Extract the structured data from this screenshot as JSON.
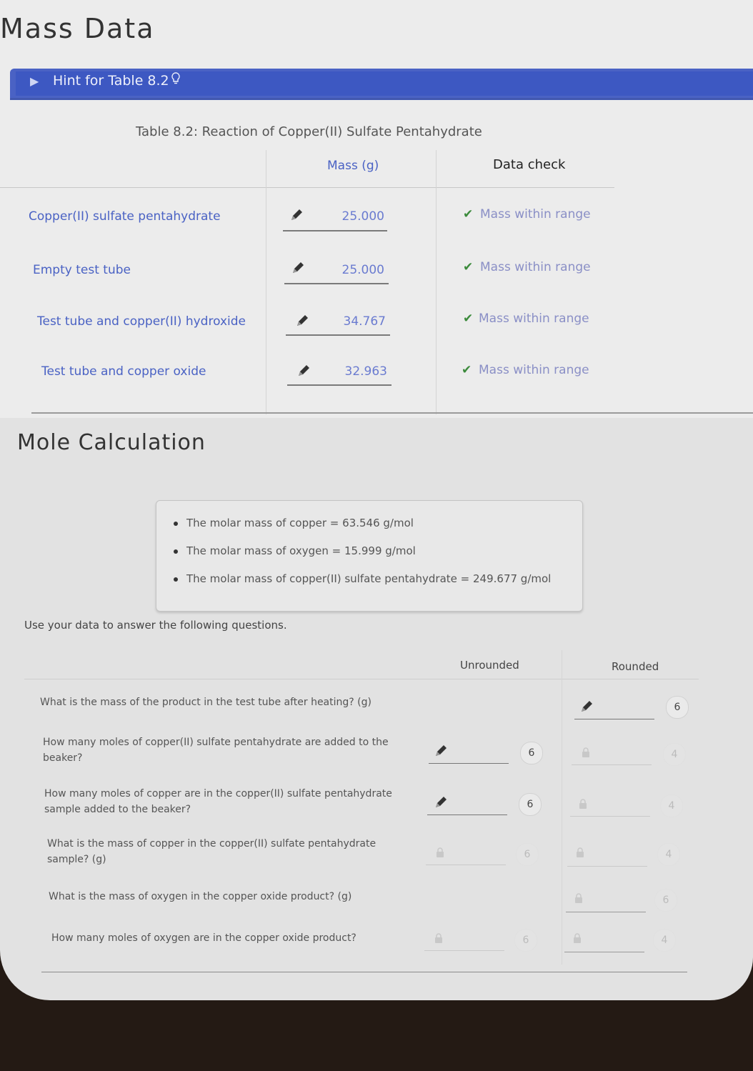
{
  "headings": {
    "mass_data": "Mass Data",
    "mole_calculation": "Mole Calculation"
  },
  "hint": {
    "label": "Hint for Table 8.2"
  },
  "mass_table": {
    "caption": "Table 8.2: Reaction of Copper(II) Sulfate Pentahydrate",
    "col_mass": "Mass (g)",
    "col_check": "Data check",
    "rows": [
      {
        "label": "Copper(II) sulfate pentahydrate",
        "value": "25.000",
        "check": "Mass within range"
      },
      {
        "label": "Empty test tube",
        "value": "25.000",
        "check": "Mass within range"
      },
      {
        "label": "Test tube and copper(II) hydroxide",
        "value": "34.767",
        "check": "Mass within range"
      },
      {
        "label": "Test tube and copper oxide",
        "value": "32.963",
        "check": "Mass within range"
      }
    ]
  },
  "molar_masses": [
    "The molar mass of copper = 63.546 g/mol",
    "The molar mass of oxygen = 15.999 g/mol",
    "The molar mass of copper(II) sulfate pentahydrate = 249.677 g/mol"
  ],
  "instructions": "Use your data to answer the following questions.",
  "questions_table": {
    "col_unrounded": "Unrounded",
    "col_rounded": "Rounded",
    "rows": [
      {
        "text": "What is the mass of the product in the test tube after heating? (g)",
        "rounded_sf": "6"
      },
      {
        "text": "How many moles of copper(II) sulfate pentahydrate are added to the beaker?",
        "unrounded_sf": "6",
        "rounded_sf": "4"
      },
      {
        "text": "How many moles of copper are in the copper(II) sulfate pentahydrate sample added to the beaker?",
        "unrounded_sf": "6",
        "rounded_sf": "4"
      },
      {
        "text": "What is the mass of copper in the copper(II) sulfate pentahydrate sample? (g)",
        "unrounded_sf": "6",
        "rounded_sf": "4"
      },
      {
        "text": "What is the mass of oxygen in the copper oxide product? (g)",
        "rounded_sf": "6"
      },
      {
        "text": "How many moles of oxygen are in the copper oxide product?",
        "unrounded_sf": "6",
        "rounded_sf": "4"
      }
    ]
  }
}
